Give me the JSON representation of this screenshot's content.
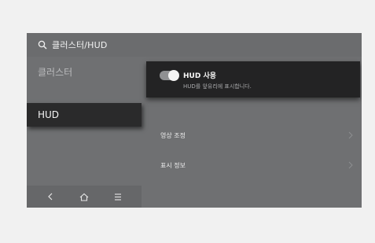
{
  "header": {
    "title": "클러스터/HUD",
    "icon": "search-icon"
  },
  "sidebar": {
    "items": [
      {
        "label": "클러스터",
        "active": false
      },
      {
        "label": "HUD",
        "active": true
      }
    ]
  },
  "bottom_nav": {
    "icons": [
      "back-icon",
      "home-icon",
      "menu-icon"
    ]
  },
  "hud": {
    "title": "HUD 사용",
    "subtitle": "HUD를 앞유리에 표시합니다.",
    "enabled": true
  },
  "rows": [
    {
      "label": "영상 조정"
    },
    {
      "label": "표시 정보"
    }
  ],
  "colors": {
    "screen_bg": "#6f7072",
    "card_bg": "#232324",
    "active_item_bg": "#2a2a2b",
    "text_primary": "#f2f2f2",
    "text_muted": "#b9babc"
  }
}
